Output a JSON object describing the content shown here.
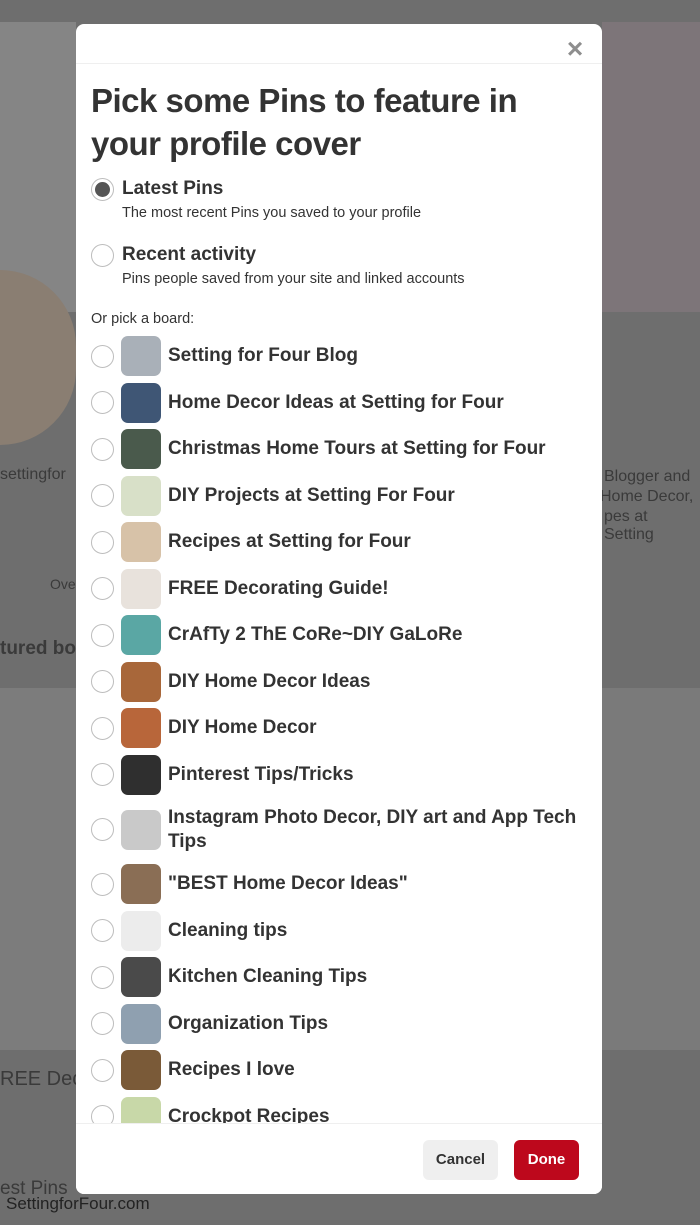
{
  "background": {
    "texts": [
      "settingfor",
      "Blogger and",
      "Home Decor,",
      "pes at Setting",
      "Ove",
      "tured bo",
      "REE Dec",
      "est Pins"
    ],
    "watermark": "SettingforFour.com"
  },
  "modal": {
    "close_icon": "close-icon",
    "title": "Pick some Pins to feature in your profile cover",
    "options": [
      {
        "label": "Latest Pins",
        "description": "The most recent Pins you saved to your profile",
        "selected": true
      },
      {
        "label": "Recent activity",
        "description": "Pins people saved from your site and linked accounts",
        "selected": false
      }
    ],
    "board_prompt": "Or pick a board:",
    "boards": [
      {
        "label": "Setting for Four Blog",
        "color": "#a9b0b8"
      },
      {
        "label": "Home Decor Ideas at Setting for Four",
        "color": "#3f5675"
      },
      {
        "label": "Christmas Home Tours at Setting for Four",
        "color": "#4a5a4c"
      },
      {
        "label": "DIY Projects at Setting For Four",
        "color": "#d8e0c8"
      },
      {
        "label": "Recipes at Setting for Four",
        "color": "#d7c2a8"
      },
      {
        "label": "FREE Decorating Guide!",
        "color": "#e8e2dc"
      },
      {
        "label": "CrAfTy 2 ThE CoRe~DIY GaLoRe",
        "color": "#5aa7a4"
      },
      {
        "label": "DIY Home Decor Ideas",
        "color": "#a8673a"
      },
      {
        "label": "DIY Home Decor",
        "color": "#b8663a"
      },
      {
        "label": "Pinterest Tips/Tricks",
        "color": "#2f2f2f"
      },
      {
        "label": "Instagram Photo Decor, DIY art and App Tech Tips",
        "color": "#c9c9c9"
      },
      {
        "label": "\"BEST Home Decor Ideas\"",
        "color": "#8a6e55"
      },
      {
        "label": "Cleaning tips",
        "color": "#ececec"
      },
      {
        "label": "Kitchen Cleaning Tips",
        "color": "#4a4a4a"
      },
      {
        "label": "Organization Tips",
        "color": "#8fa0b0"
      },
      {
        "label": "Recipes I love",
        "color": "#7a5a38"
      },
      {
        "label": "Crockpot Recipes",
        "color": "#c8d8a8"
      }
    ],
    "cancel_label": "Cancel",
    "done_label": "Done",
    "done_color": "#bd081c"
  }
}
